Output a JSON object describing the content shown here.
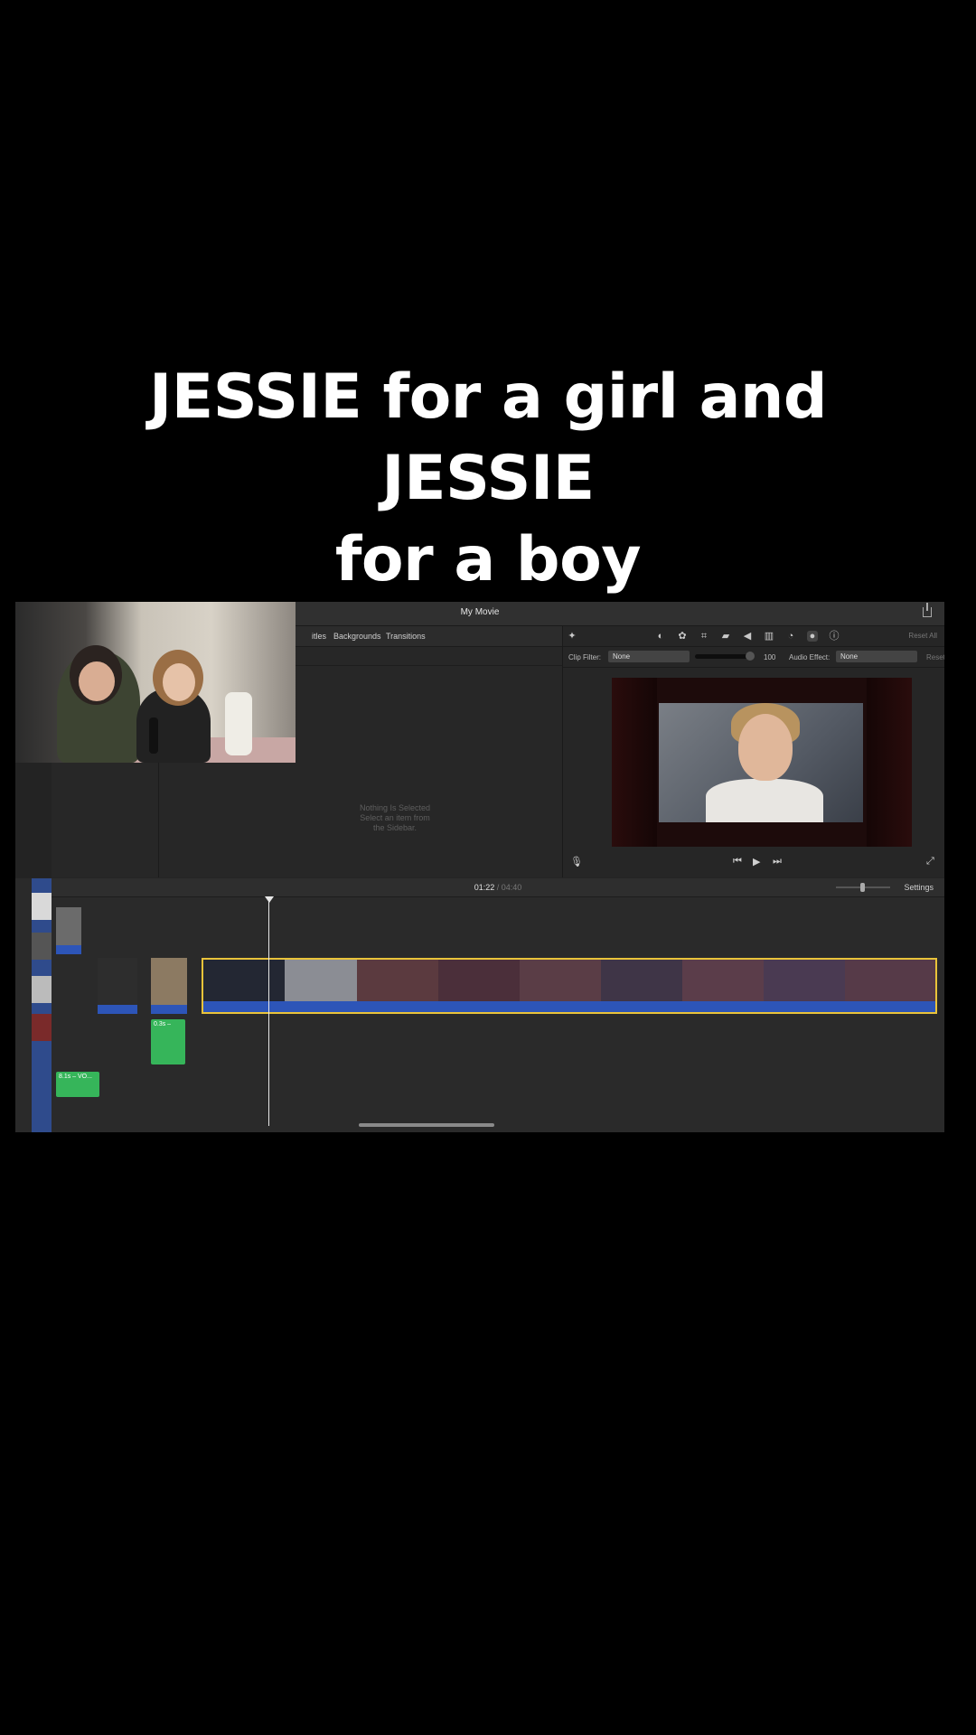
{
  "caption": {
    "line1": "JESSIE for a girl and JESSIE",
    "line2": "for a boy"
  },
  "app": {
    "window_title": "My Movie",
    "browser_tabs": [
      "itles",
      "Backgrounds",
      "Transitions"
    ],
    "empty_message": {
      "line1": "Nothing Is Selected",
      "line2": "Select an item from",
      "line3": "the Sidebar."
    },
    "viewer": {
      "reset_all_label": "Reset All",
      "clip_filter_label": "Clip Filter:",
      "clip_filter_value": "None",
      "slider_value": "100",
      "audio_effect_label": "Audio Effect:",
      "audio_effect_value": "None",
      "reset_label": "Reset"
    },
    "timeline": {
      "current_time": "01:22",
      "separator": "/",
      "total_time": "04:40",
      "settings_label": "Settings",
      "green_clip_1": "0.3s –",
      "green_clip_2": "8.1s – VO..."
    },
    "colors": {
      "selection_border": "#e9c33a",
      "audio_track": "#2d55b8",
      "voiceover_clip": "#36b55a"
    }
  }
}
